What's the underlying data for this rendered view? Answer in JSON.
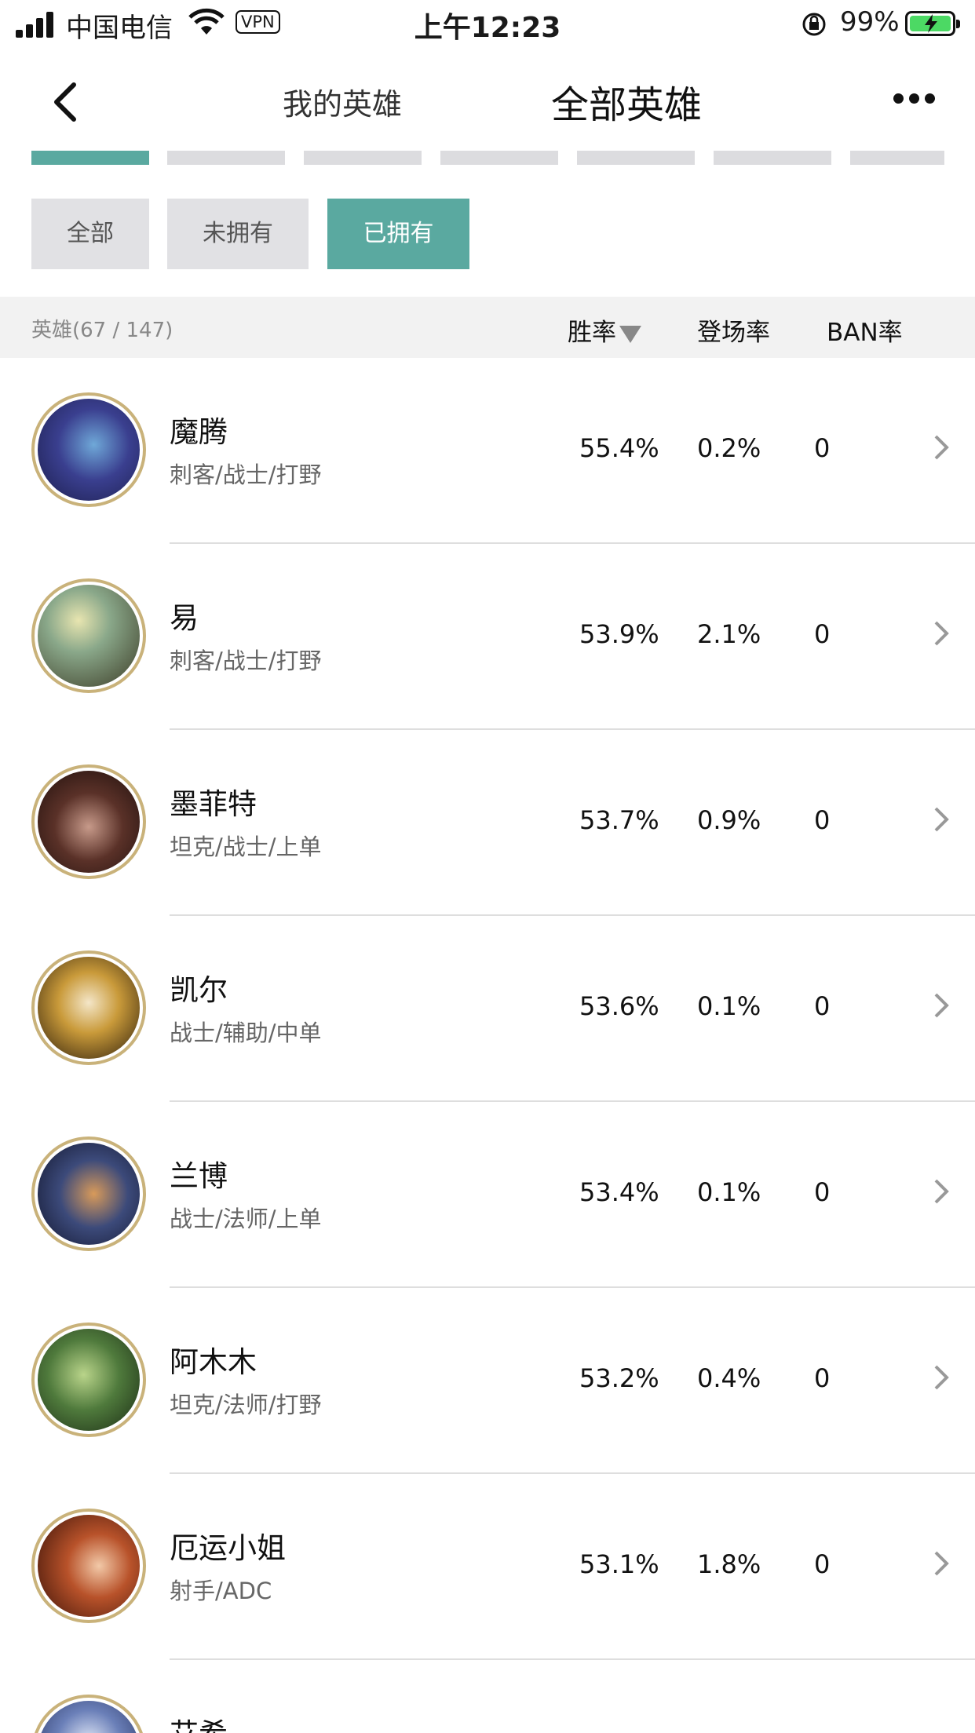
{
  "status": {
    "carrier": "中国电信",
    "vpn": "VPN",
    "time": "上午12:23",
    "battery": "99%"
  },
  "nav": {
    "tab_mine": "我的英雄",
    "tab_all": "全部英雄"
  },
  "filters": [
    "全部",
    "未拥有",
    "已拥有"
  ],
  "header": {
    "count": "英雄(67 / 147)",
    "win_rate": "胜率",
    "pick_rate": "登场率",
    "ban_rate": "BAN率"
  },
  "heroes": [
    {
      "name": "魔腾",
      "roles": "刺客/战士/打野",
      "win": "55.4%",
      "pick": "0.2%",
      "ban": "0"
    },
    {
      "name": "易",
      "roles": "刺客/战士/打野",
      "win": "53.9%",
      "pick": "2.1%",
      "ban": "0"
    },
    {
      "name": "墨菲特",
      "roles": "坦克/战士/上单",
      "win": "53.7%",
      "pick": "0.9%",
      "ban": "0"
    },
    {
      "name": "凯尔",
      "roles": "战士/辅助/中单",
      "win": "53.6%",
      "pick": "0.1%",
      "ban": "0"
    },
    {
      "name": "兰博",
      "roles": "战士/法师/上单",
      "win": "53.4%",
      "pick": "0.1%",
      "ban": "0"
    },
    {
      "name": "阿木木",
      "roles": "坦克/法师/打野",
      "win": "53.2%",
      "pick": "0.4%",
      "ban": "0"
    },
    {
      "name": "厄运小姐",
      "roles": "射手/ADC",
      "win": "53.1%",
      "pick": "1.8%",
      "ban": "0"
    },
    {
      "name": "艾希",
      "roles": "",
      "win": "",
      "pick": "",
      "ban": ""
    }
  ],
  "colors": {
    "accent": "#5aa9a0",
    "avatar_ring": "#c9b27a"
  }
}
